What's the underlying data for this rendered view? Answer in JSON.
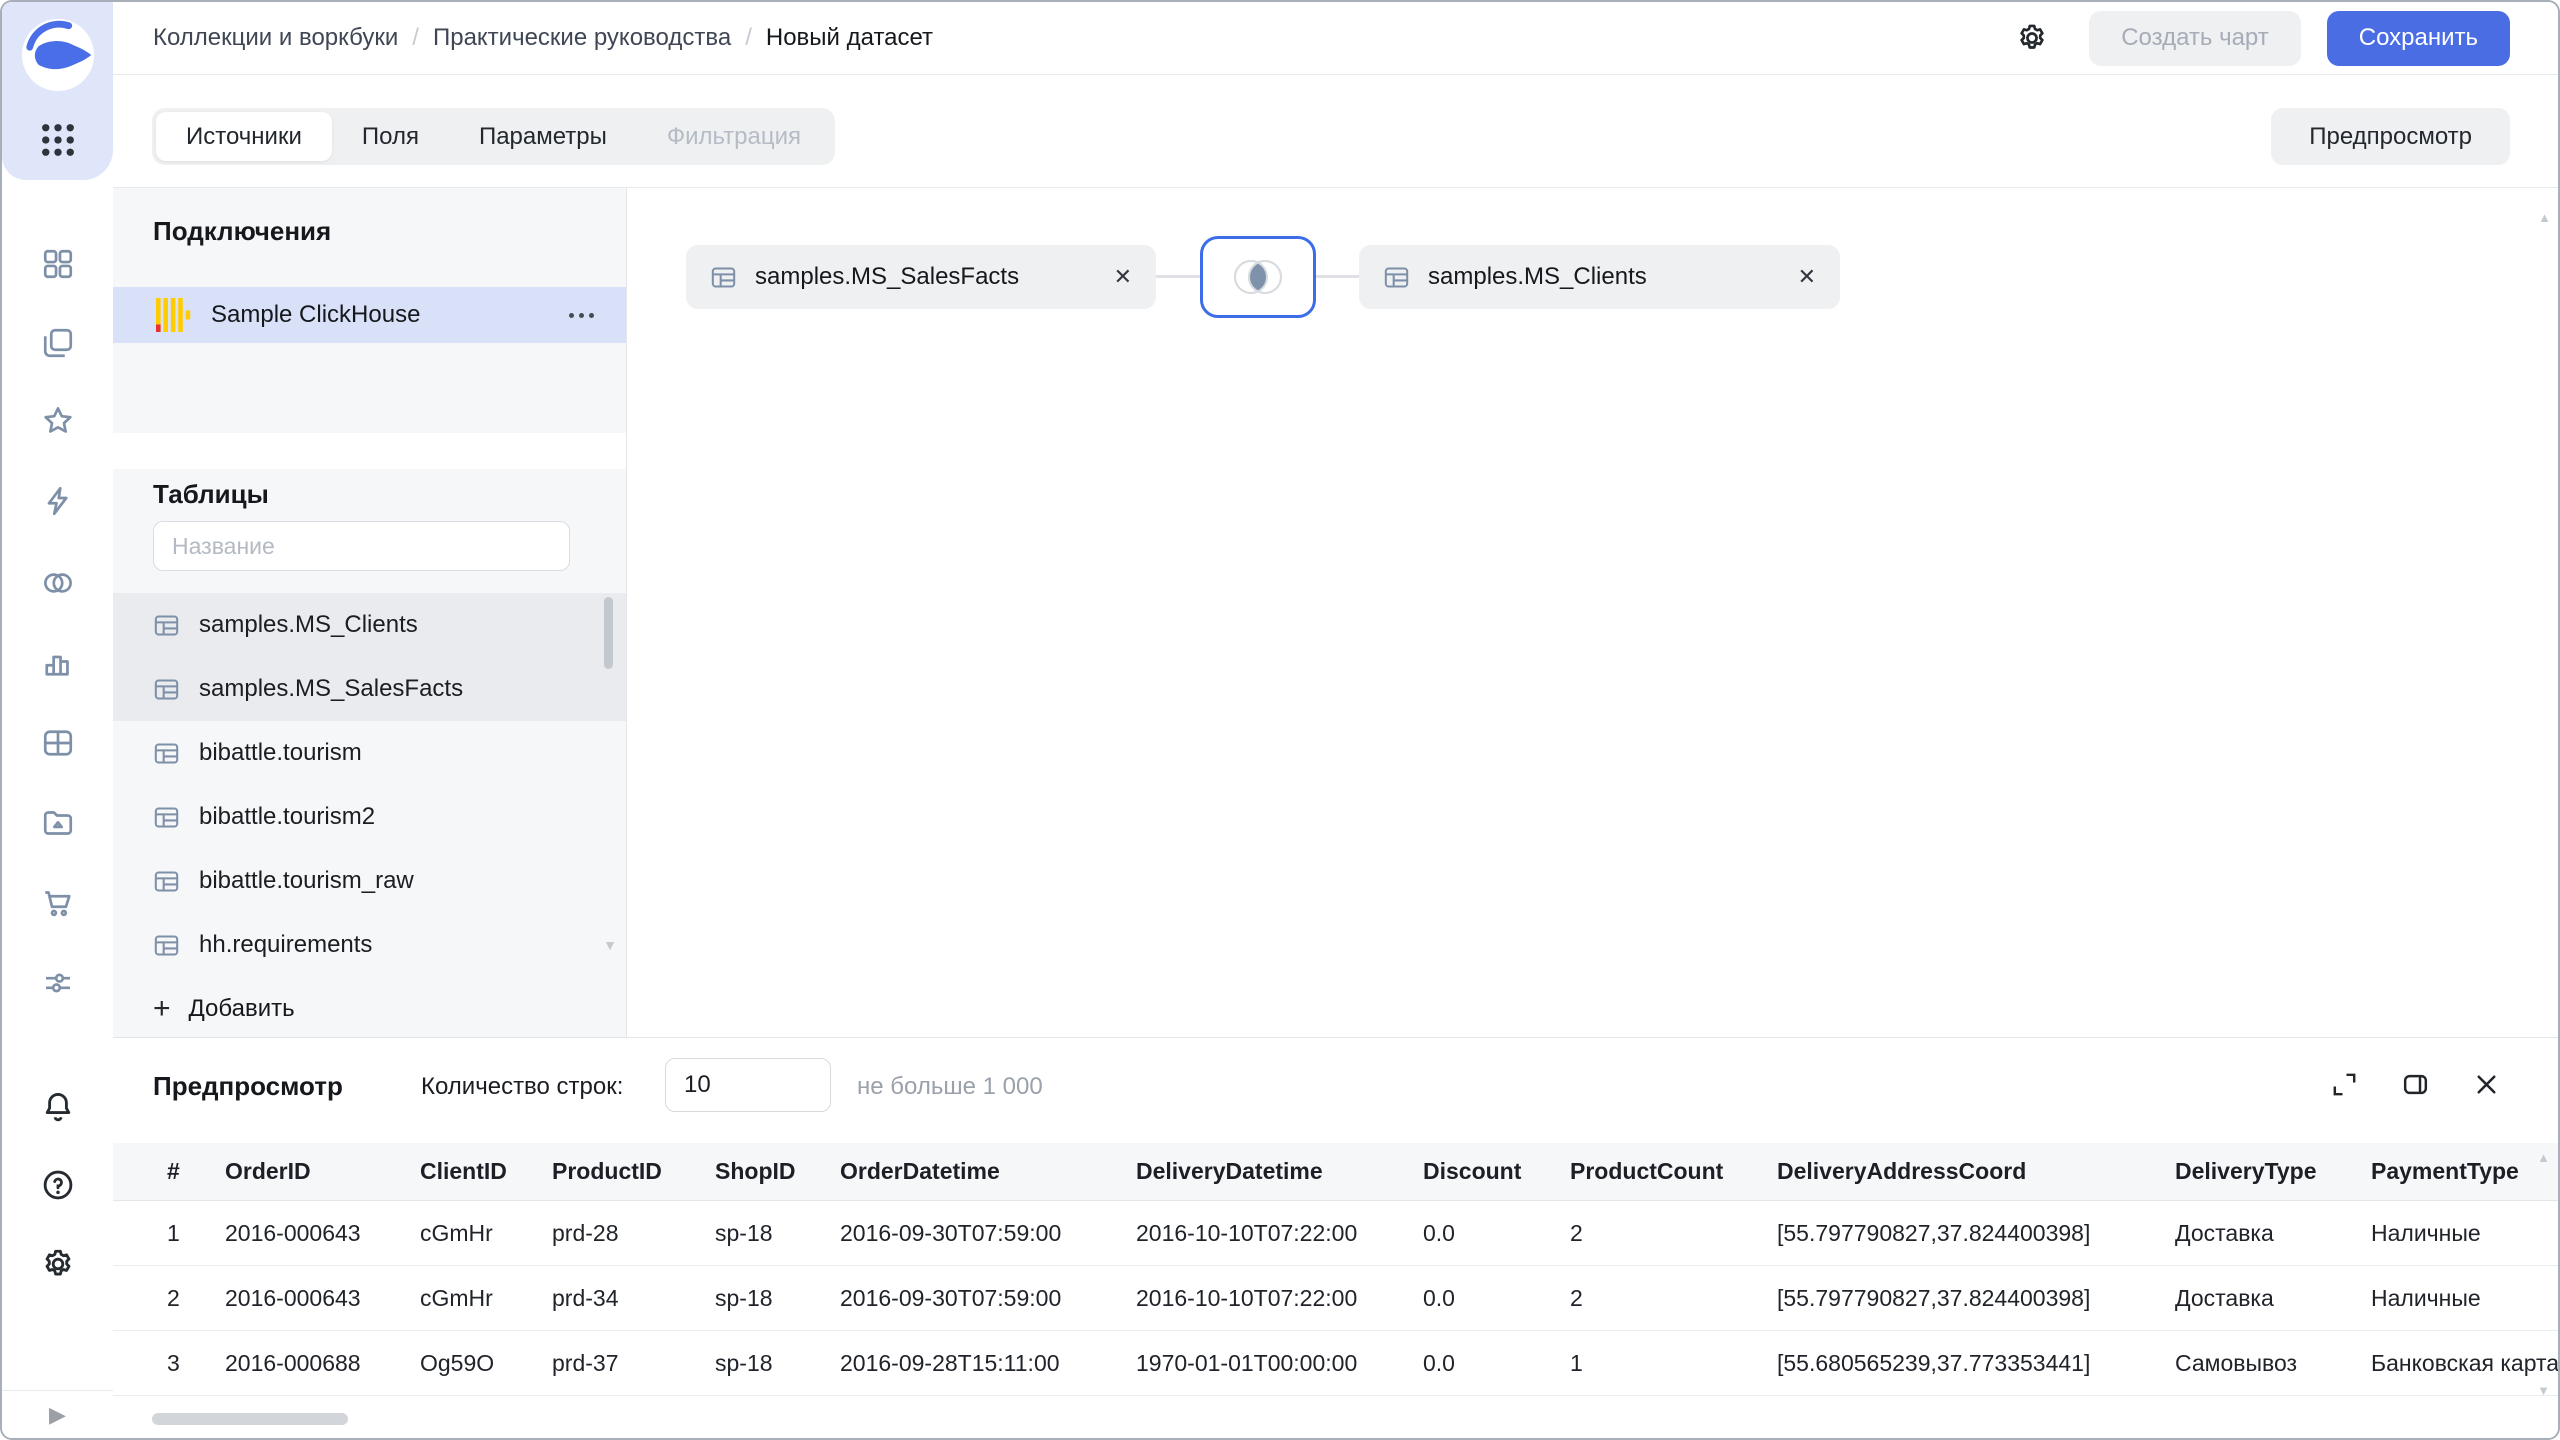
{
  "header": {
    "breadcrumb": [
      "Коллекции и воркбуки",
      "Практические руководства",
      "Новый датасет"
    ],
    "breadcrumb_separator": "/",
    "create_chart_label": "Создать чарт",
    "save_label": "Сохранить"
  },
  "tabs": [
    {
      "label": "Источники",
      "state": "active"
    },
    {
      "label": "Поля",
      "state": "normal"
    },
    {
      "label": "Параметры",
      "state": "normal"
    },
    {
      "label": "Фильтрация",
      "state": "disabled"
    }
  ],
  "preview_toggle_label": "Предпросмотр",
  "connections": {
    "title": "Подключения",
    "items": [
      {
        "name": "Sample ClickHouse",
        "selected": true
      }
    ]
  },
  "tables_panel": {
    "title": "Таблицы",
    "search_placeholder": "Название",
    "items": [
      {
        "name": "samples.MS_Clients",
        "used": true
      },
      {
        "name": "samples.MS_SalesFacts",
        "used": true
      },
      {
        "name": "bibattle.tourism",
        "used": false
      },
      {
        "name": "bibattle.tourism2",
        "used": false
      },
      {
        "name": "bibattle.tourism_raw",
        "used": false
      },
      {
        "name": "hh.requirements",
        "used": false
      }
    ],
    "add_label": "Добавить"
  },
  "canvas": {
    "nodes": [
      {
        "name": "samples.MS_SalesFacts"
      },
      {
        "name": "samples.MS_Clients"
      }
    ],
    "join_type": "inner"
  },
  "preview": {
    "title": "Предпросмотр",
    "row_count_label": "Количество строк:",
    "row_count_value": "10",
    "row_count_hint": "не больше 1 000",
    "table": {
      "columns": [
        "#",
        "OrderID",
        "ClientID",
        "ProductID",
        "ShopID",
        "OrderDatetime",
        "DeliveryDatetime",
        "Discount",
        "ProductCount",
        "DeliveryAddressCoord",
        "DeliveryType",
        "PaymentType"
      ],
      "rows": [
        [
          "1",
          "2016-000643",
          "cGmHr",
          "prd-28",
          "sp-18",
          "2016-09-30T07:59:00",
          "2016-10-10T07:22:00",
          "0.0",
          "2",
          "[55.797790827,37.824400398]",
          "Доставка",
          "Наличные"
        ],
        [
          "2",
          "2016-000643",
          "cGmHr",
          "prd-34",
          "sp-18",
          "2016-09-30T07:59:00",
          "2016-10-10T07:22:00",
          "0.0",
          "2",
          "[55.797790827,37.824400398]",
          "Доставка",
          "Наличные"
        ],
        [
          "3",
          "2016-000688",
          "Og59O",
          "prd-37",
          "sp-18",
          "2016-09-28T15:11:00",
          "1970-01-01T00:00:00",
          "0.0",
          "1",
          "[55.680565239,37.773353441]",
          "Самовывоз",
          "Банковская карта"
        ]
      ]
    }
  },
  "icons": {
    "close": "✕",
    "play": "▶",
    "scroll_up": "▲",
    "scroll_down": "▼",
    "add": "+"
  },
  "colors": {
    "accent_blue": "#4b6de4",
    "join_border": "#3c6ce8",
    "clickhouse_yellow": "#ffcc00",
    "clickhouse_red": "#e6322e",
    "selected_connection_bg": "#d9e1f8",
    "panel_bg": "#f6f7f8"
  }
}
